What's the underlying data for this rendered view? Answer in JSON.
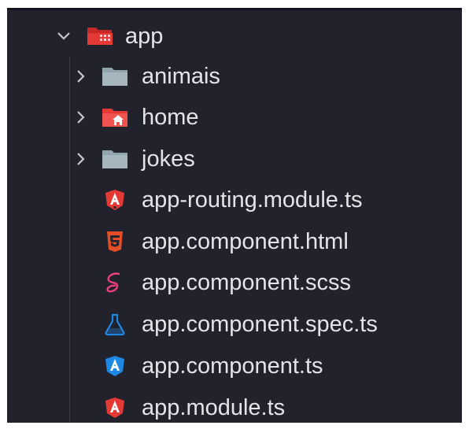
{
  "tree": {
    "root": {
      "label": "app",
      "icon": "folder-app-open-icon",
      "expanded": true,
      "icon_color": "#e53935"
    },
    "items": [
      {
        "label": "animais",
        "type": "folder",
        "icon": "folder-icon",
        "expanded": false,
        "icon_color": "#90a4ae"
      },
      {
        "label": "home",
        "type": "folder",
        "icon": "folder-home-icon",
        "expanded": false,
        "icon_color": "#ef5350"
      },
      {
        "label": "jokes",
        "type": "folder",
        "icon": "folder-icon",
        "expanded": false,
        "icon_color": "#90a4ae"
      },
      {
        "label": "app-routing.module.ts",
        "type": "file",
        "icon": "angular-routing-icon",
        "icon_color": "#e53935"
      },
      {
        "label": "app.component.html",
        "type": "file",
        "icon": "html5-icon",
        "icon_color": "#e44d26"
      },
      {
        "label": "app.component.scss",
        "type": "file",
        "icon": "sass-icon",
        "icon_color": "#ec407a"
      },
      {
        "label": "app.component.spec.ts",
        "type": "file",
        "icon": "test-flask-icon",
        "icon_color": "#1e88e5"
      },
      {
        "label": "app.component.ts",
        "type": "file",
        "icon": "angular-component-icon",
        "icon_color": "#1e88e5"
      },
      {
        "label": "app.module.ts",
        "type": "file",
        "icon": "angular-module-icon",
        "icon_color": "#e53935"
      }
    ]
  },
  "colors": {
    "background": "#21222c",
    "text": "#e4e4e8",
    "chevron": "#c8c8cc"
  }
}
